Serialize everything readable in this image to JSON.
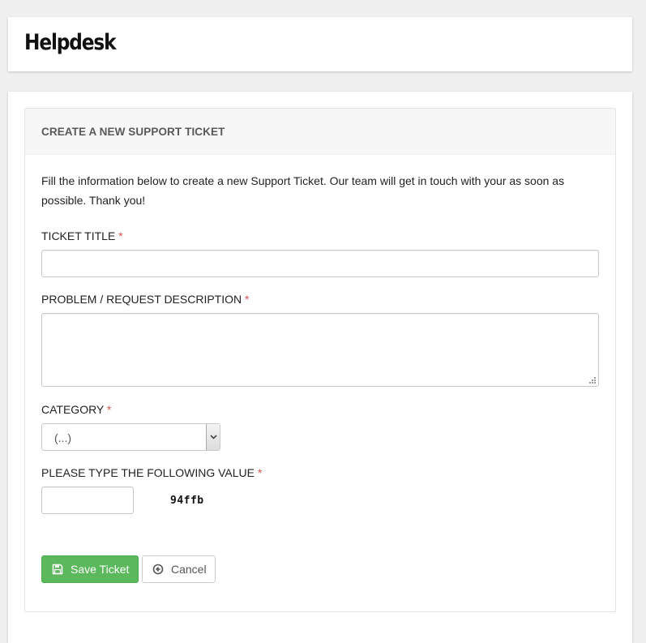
{
  "app": {
    "brand": "Helpdesk"
  },
  "form": {
    "heading": "CREATE A NEW SUPPORT TICKET",
    "intro": "Fill the information below to create a new Support Ticket. Our team will get in touch with your as soon as possible. Thank you!",
    "required_marker": "*",
    "title": {
      "label": "TICKET TITLE",
      "value": "",
      "placeholder": ""
    },
    "description": {
      "label": "PROBLEM / REQUEST DESCRIPTION",
      "value": "",
      "placeholder": ""
    },
    "category": {
      "label": "CATEGORY",
      "selected": "(...)"
    },
    "captcha": {
      "label": "PLEASE TYPE THE FOLLOWING VALUE",
      "value": "",
      "code": "94ffb"
    },
    "buttons": {
      "save": "Save Ticket",
      "cancel": "Cancel"
    }
  },
  "colors": {
    "save_button": "#5cb85c",
    "required": "#d9534f",
    "heading_text": "#58595b"
  },
  "icons": {
    "save": "floppy-disk-icon",
    "cancel": "circle-arrow-left-icon",
    "select": "chevron-down-icon"
  }
}
